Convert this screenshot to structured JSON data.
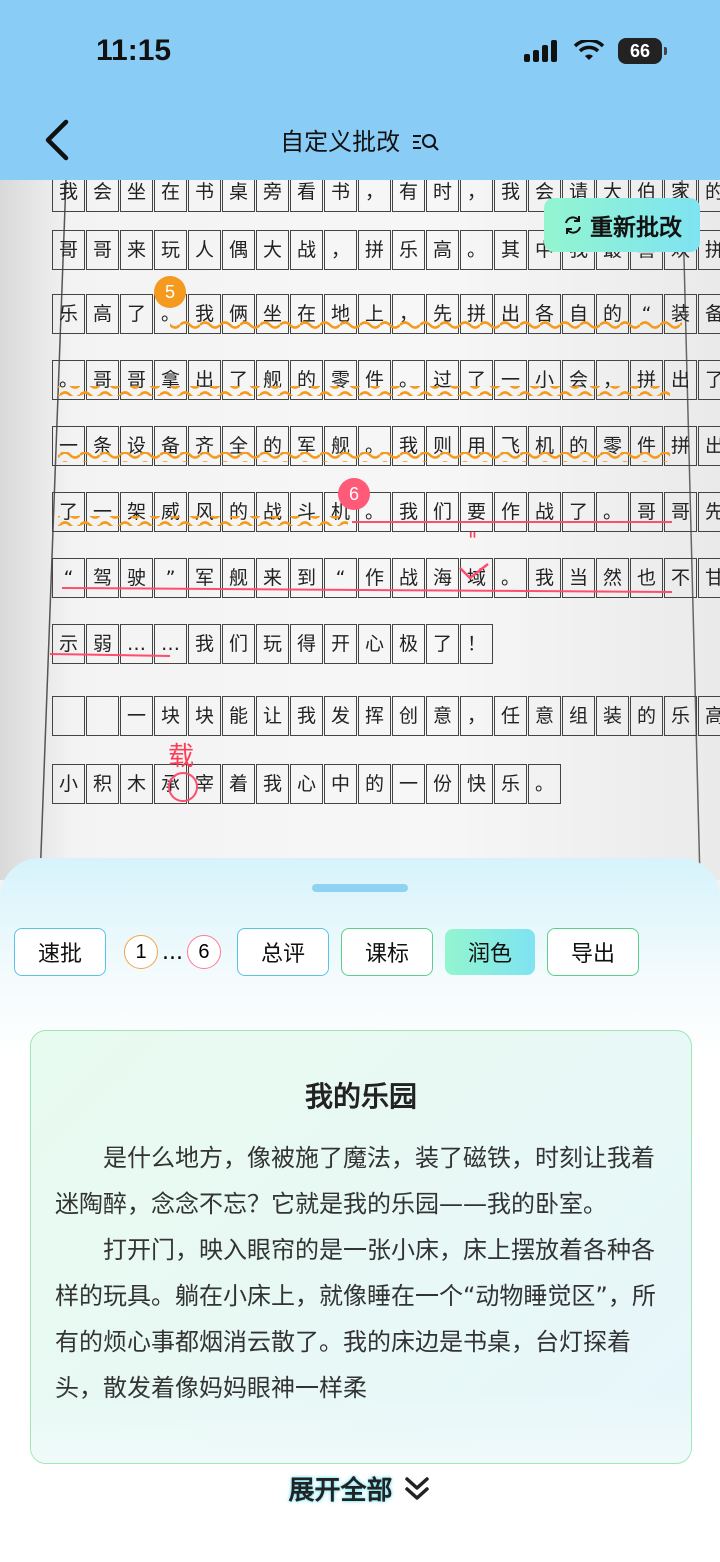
{
  "status": {
    "time": "11:15",
    "battery": "66"
  },
  "header": {
    "title": "自定义批改"
  },
  "photo": {
    "rows": [
      [
        "我",
        "会",
        "坐",
        "在",
        "书",
        "桌",
        "旁",
        "看",
        "书",
        "，",
        "有",
        "时",
        "，",
        "我",
        "会",
        "请",
        "大",
        "伯",
        "家",
        "的"
      ],
      [
        "哥",
        "哥",
        "来",
        "玩",
        "人",
        "偶",
        "大",
        "战",
        "，",
        "拼",
        "乐",
        "高",
        "。",
        "其",
        "中",
        "我",
        "最",
        "喜",
        "欢",
        "拼"
      ],
      [
        "乐",
        "高",
        "了",
        "。",
        "我",
        "俩",
        "坐",
        "在",
        "地",
        "上",
        "，",
        "先",
        "拼",
        "出",
        "各",
        "自",
        "的",
        "“",
        "装",
        "备",
        "”"
      ],
      [
        "。",
        "哥",
        "哥",
        "拿",
        "出",
        "了",
        "舰",
        "的",
        "零",
        "件",
        "。",
        "过",
        "了",
        "一",
        "小",
        "会",
        "，",
        "拼",
        "出",
        "了"
      ],
      [
        "一",
        "条",
        "设",
        "备",
        "齐",
        "全",
        "的",
        "军",
        "舰",
        "。",
        "我",
        "则",
        "用",
        "飞",
        "机",
        "的",
        "零",
        "件",
        "拼",
        "出"
      ],
      [
        "了",
        "一",
        "架",
        "威",
        "风",
        "的",
        "战",
        "斗",
        "机",
        "。",
        "我",
        "们",
        "要",
        "作",
        "战",
        "了",
        "。",
        "哥",
        "哥",
        "先"
      ],
      [
        "“",
        "驾",
        "驶",
        "”",
        "军",
        "舰",
        "来",
        "到",
        "“",
        "作",
        "战",
        "海",
        "域",
        "。",
        "我",
        "当",
        "然",
        "也",
        "不",
        "甘"
      ],
      [
        "示",
        "弱",
        "…",
        "…",
        "我",
        "们",
        "玩",
        "得",
        "开",
        "心",
        "极",
        "了",
        "！"
      ],
      [
        "",
        "",
        "一",
        "块",
        "块",
        "能",
        "让",
        "我",
        "发",
        "挥",
        "创",
        "意",
        "，",
        "任",
        "意",
        "组",
        "装",
        "的",
        "乐",
        "高"
      ],
      [
        "小",
        "积",
        "木",
        "承",
        "宰",
        "着",
        "我",
        "心",
        "中",
        "的",
        "一",
        "份",
        "快",
        "乐",
        "。"
      ]
    ],
    "badge5": "5",
    "badge6": "6",
    "correction": "载",
    "quote_mark": "\""
  },
  "redo_button": "重新批改",
  "toolbar": {
    "quick": "速批",
    "num_first": "1",
    "ellipsis": "...",
    "num_last": "6",
    "overall": "总评",
    "standard": "课标",
    "polish": "润色",
    "export": "导出"
  },
  "card": {
    "title": "我的乐园",
    "p1": "是什么地方，像被施了魔法，装了磁铁，时刻让我着迷陶醉，念念不忘？它就是我的乐园——我的卧室。",
    "p2": "打开门，映入眼帘的是一张小床，床上摆放着各种各样的玩具。躺在小床上，就像睡在一个“动物睡觉区”，所有的烦心事都烟消云散了。我的床边是书桌，台灯探着头，散发着像妈妈眼神一样柔"
  },
  "expand": "展开全部",
  "colors": {
    "header": "#89cdf6",
    "accent_orange": "#f39a1f",
    "accent_red": "#ff5a78",
    "green_border": "#5bd08a"
  }
}
